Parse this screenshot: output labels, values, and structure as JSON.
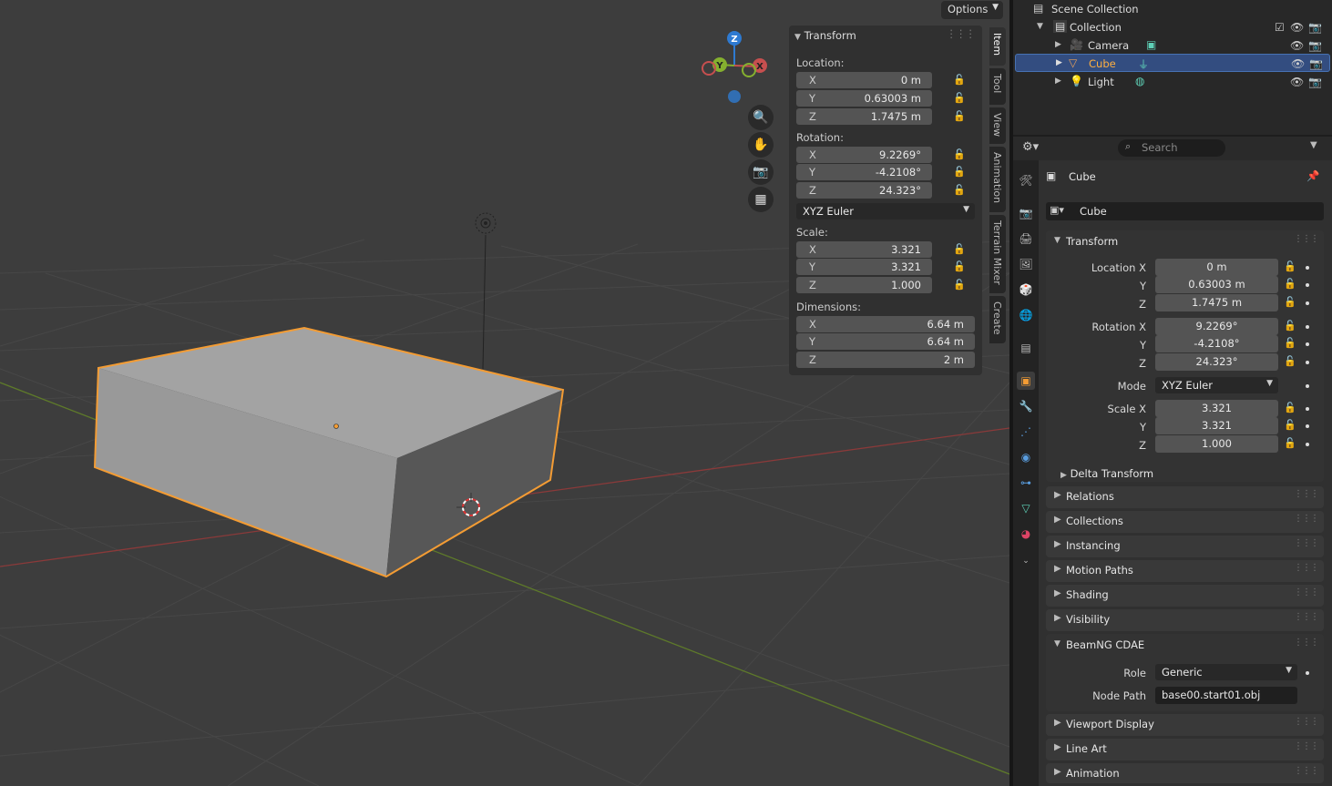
{
  "viewport": {
    "options_label": "Options",
    "gizmo": {
      "z": "Z",
      "y": "Y",
      "x": "X"
    }
  },
  "npanel": {
    "header": "Transform",
    "location_label": "Location:",
    "location": [
      {
        "axis": "X",
        "value": "0 m"
      },
      {
        "axis": "Y",
        "value": "0.63003 m"
      },
      {
        "axis": "Z",
        "value": "1.7475 m"
      }
    ],
    "rotation_label": "Rotation:",
    "rotation": [
      {
        "axis": "X",
        "value": "9.2269°"
      },
      {
        "axis": "Y",
        "value": "-4.2108°"
      },
      {
        "axis": "Z",
        "value": "24.323°"
      }
    ],
    "rotation_mode": "XYZ Euler",
    "scale_label": "Scale:",
    "scale": [
      {
        "axis": "X",
        "value": "3.321"
      },
      {
        "axis": "Y",
        "value": "3.321"
      },
      {
        "axis": "Z",
        "value": "1.000"
      }
    ],
    "dimensions_label": "Dimensions:",
    "dimensions": [
      {
        "axis": "X",
        "value": "6.64 m"
      },
      {
        "axis": "Y",
        "value": "6.64 m"
      },
      {
        "axis": "Z",
        "value": "2 m"
      }
    ],
    "tabs": [
      "Item",
      "Tool",
      "View",
      "Animation",
      "Terrain Mixer",
      "Create"
    ]
  },
  "outliner": {
    "root": "Scene Collection",
    "collection": "Collection",
    "items": [
      "Camera",
      "Cube",
      "Light"
    ]
  },
  "properties": {
    "search_placeholder": "Search",
    "object_name": "Cube",
    "data_name": "Cube",
    "transform_header": "Transform",
    "location_x_label": "Location X",
    "y_label": "Y",
    "z_label": "Z",
    "location": [
      "0 m",
      "0.63003 m",
      "1.7475 m"
    ],
    "rotation_x_label": "Rotation X",
    "rotation": [
      "9.2269°",
      "-4.2108°",
      "24.323°"
    ],
    "mode_label": "Mode",
    "mode_value": "XYZ Euler",
    "scale_x_label": "Scale X",
    "scale": [
      "3.321",
      "3.321",
      "1.000"
    ],
    "delta_transform": "Delta Transform",
    "panels": [
      "Relations",
      "Collections",
      "Instancing",
      "Motion Paths",
      "Shading",
      "Visibility"
    ],
    "beamng_header": "BeamNG CDAE",
    "role_label": "Role",
    "role_value": "Generic",
    "node_path_label": "Node Path",
    "node_path_value": "base00.start01.obj",
    "panels_after": [
      "Viewport Display",
      "Line Art",
      "Animation"
    ]
  },
  "colors": {
    "accent": "#4772b3",
    "selection_outline": "#f39c34",
    "x_axis": "#c64f4f",
    "y_axis": "#85b02f",
    "z_axis": "#2e7ad1"
  }
}
